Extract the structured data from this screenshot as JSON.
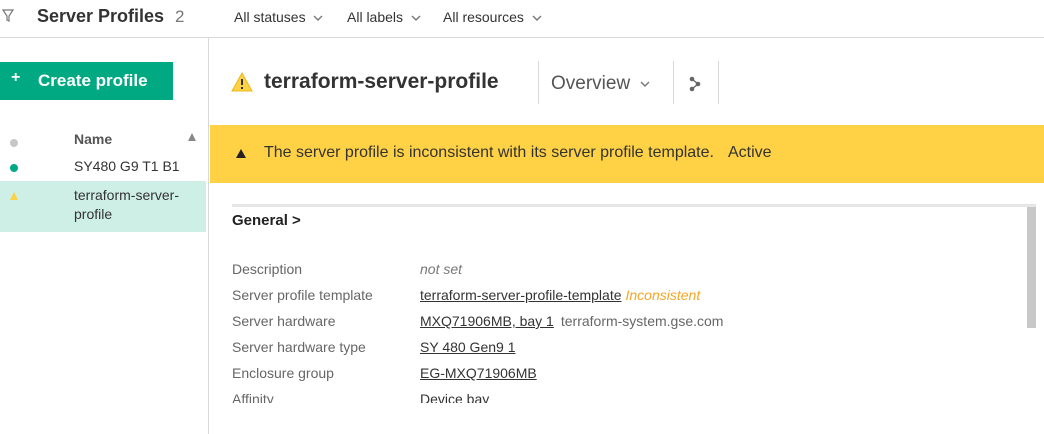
{
  "header": {
    "title": "Server Profiles",
    "count": "2",
    "filters": [
      {
        "label": "All statuses"
      },
      {
        "label": "All labels"
      },
      {
        "label": "All resources"
      }
    ]
  },
  "sidebar": {
    "create_button": {
      "plus": "+",
      "label": "Create profile"
    },
    "column_name": "Name",
    "items": [
      {
        "label": "SY480 G9 T1 B1",
        "status": "ok"
      },
      {
        "label": "terraform-server-profile",
        "status": "warning",
        "selected": true
      }
    ]
  },
  "main": {
    "title": "terraform-server-profile",
    "view": "Overview",
    "banner": {
      "message": "The server profile is inconsistent with its server profile template.",
      "state": "Active"
    },
    "section_title": "General >",
    "details": {
      "description": {
        "label": "Description",
        "value": "not set"
      },
      "template": {
        "label": "Server profile template",
        "value": "terraform-server-profile-template",
        "badge": "Inconsistent"
      },
      "hardware": {
        "label": "Server hardware",
        "value": "MXQ71906MB, bay 1",
        "extra": "terraform-system.gse.com"
      },
      "hardware_type": {
        "label": "Server hardware type",
        "value": "SY 480 Gen9 1"
      },
      "enclosure_group": {
        "label": "Enclosure group",
        "value": "EG-MXQ71906MB"
      },
      "affinity": {
        "label": "Affinity",
        "value": "Device bay"
      }
    }
  },
  "colors": {
    "accent_green": "#01a982",
    "warning_yellow": "#ffd144",
    "selected_row": "#cdefe6",
    "inconsistent_orange": "#f5a623"
  },
  "icons": [
    "filter-icon",
    "chevron-down-icon",
    "warning-icon",
    "status-ok-icon",
    "sort-ascending-icon",
    "map-view-icon"
  ]
}
